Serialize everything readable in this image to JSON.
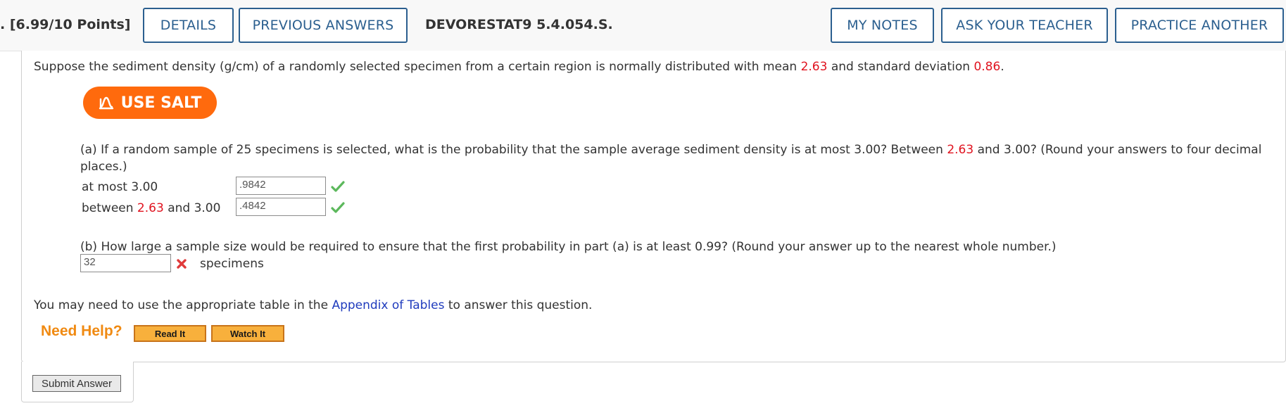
{
  "header": {
    "points": ". [6.99/10 Points]",
    "details_label": "DETAILS",
    "previous_answers_label": "PREVIOUS ANSWERS",
    "question_id": "DEVORESTAT9 5.4.054.S.",
    "my_notes_label": "MY NOTES",
    "ask_teacher_label": "ASK YOUR TEACHER",
    "practice_another_label": "PRACTICE ANOTHER"
  },
  "question": {
    "intro_a": "Suppose the sediment density (g/cm) of a randomly selected specimen from a certain region is normally distributed with mean",
    "mean": "2.63",
    "intro_b": "and standard deviation",
    "sd": "0.86",
    "intro_c": ".",
    "salt_label": "USE SALT",
    "part_a": {
      "text_a": "(a) If a random sample of 25 specimens is selected, what is the probability that the sample average sediment density is at most 3.00? Between",
      "red_value": "2.63",
      "text_b": "and 3.00? (Round your answers to four decimal",
      "text_line2": "places.)",
      "row1_label": "at most 3.00",
      "row1_value": ".9842",
      "row2_label_a": "between",
      "row2_red": "2.63",
      "row2_label_b": "and 3.00",
      "row2_value": ".4842"
    },
    "part_b": {
      "text": "(b) How large a sample size would be required to ensure that the first probability in part (a) is at least 0.99? (Round your answer up to the nearest whole number.)",
      "value": "32",
      "unit": "specimens"
    },
    "footer_a": "You may need to use the appropriate table in the",
    "footer_link": "Appendix of Tables",
    "footer_b": "to answer this question."
  },
  "help": {
    "label": "Need Help?",
    "read_it": "Read It",
    "watch_it": "Watch It"
  },
  "submit_label": "Submit Answer",
  "colors": {
    "accent_blue": "#2b5f8f",
    "salt_orange": "#ff6a0d",
    "value_red": "#e0131f",
    "check_green": "#5cb85c",
    "cross_red": "#e03a3a"
  }
}
